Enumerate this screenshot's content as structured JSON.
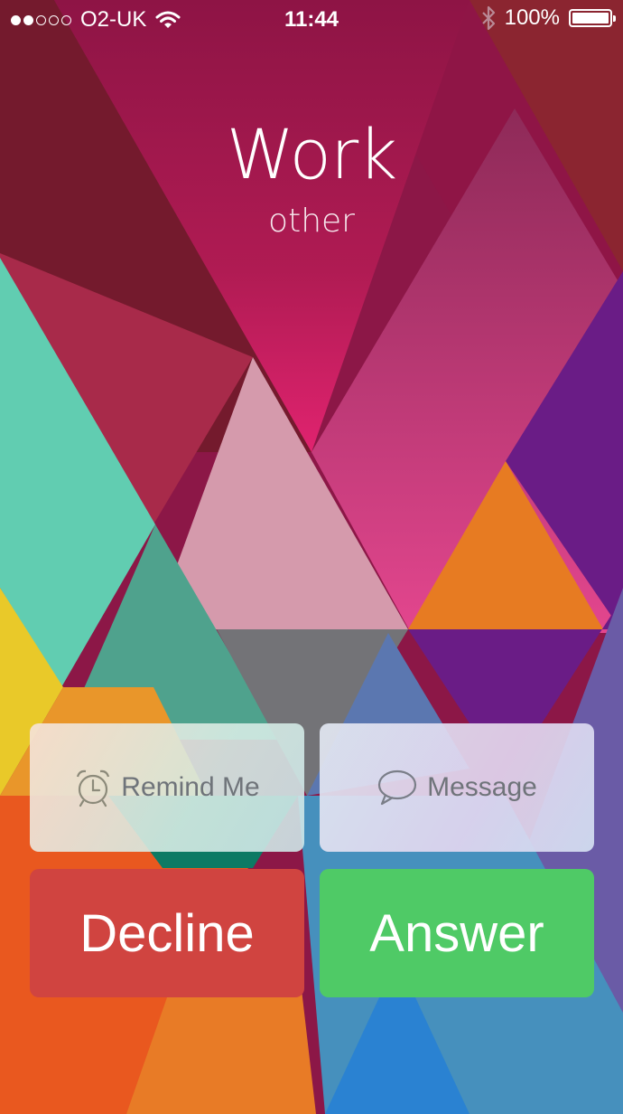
{
  "status_bar": {
    "signal_filled": 2,
    "signal_total": 5,
    "carrier": "O2-UK",
    "wifi_icon": "wifi-icon",
    "time": "11:44",
    "bluetooth_icon": "bluetooth-icon",
    "battery_percent": "100%",
    "battery_level": 1.0
  },
  "caller": {
    "name": "Work",
    "label": "other"
  },
  "actions": {
    "remind_label": "Remind Me",
    "remind_icon": "alarm-clock-icon",
    "message_label": "Message",
    "message_icon": "speech-bubble-icon",
    "decline_label": "Decline",
    "answer_label": "Answer"
  },
  "colors": {
    "decline": "#d04440",
    "answer": "#4fca66"
  }
}
